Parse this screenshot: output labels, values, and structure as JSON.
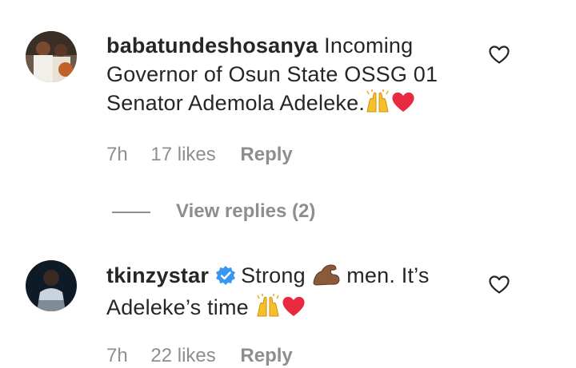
{
  "comments": [
    {
      "username": "babatundeshosanya",
      "text": "Incoming Governor of Osun State OSSG 01 Senator Ademola Adeleke.",
      "time": "7h",
      "likes": "17 likes",
      "reply_label": "Reply",
      "verified": false,
      "emojis": [
        "raising-hands",
        "red-heart"
      ]
    },
    {
      "username": "tkinzystar",
      "text_before": "Strong",
      "text_mid": "men. It’s Adeleke’s time",
      "time": "7h",
      "likes": "22 likes",
      "reply_label": "Reply",
      "verified": true,
      "emojis": [
        "flexed-biceps",
        "raising-hands",
        "red-heart"
      ]
    }
  ],
  "view_replies": {
    "label": "View replies (2)"
  },
  "colors": {
    "text": "#262626",
    "muted": "#8e8e8e",
    "verified_blue": "#3897f0",
    "heart_red": "#ed4956",
    "hands_yellow": "#f7c02b",
    "biceps_brown": "#8a5a3a"
  }
}
